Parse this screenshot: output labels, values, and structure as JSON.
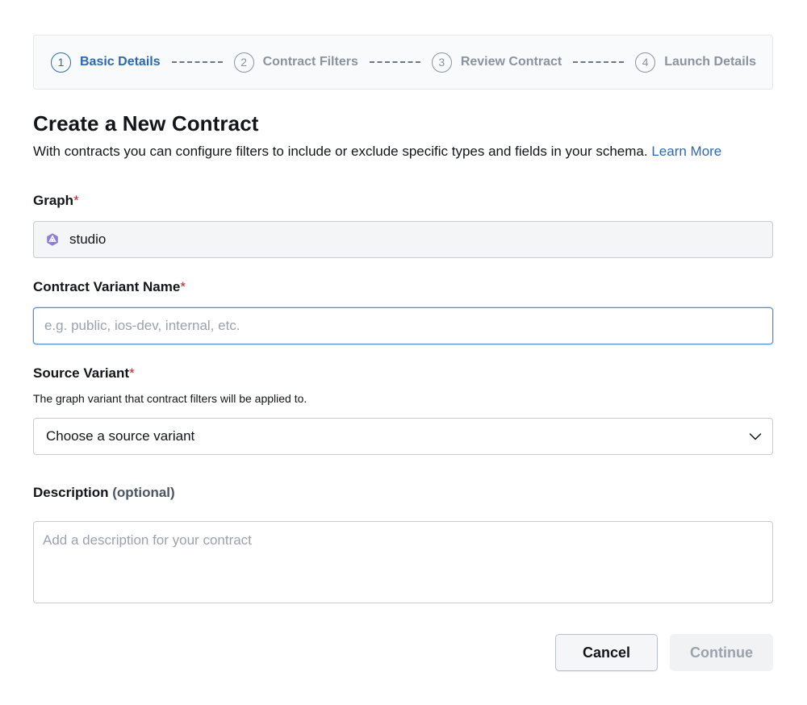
{
  "stepper": {
    "steps": [
      {
        "number": "1",
        "label": "Basic Details",
        "state": "active"
      },
      {
        "number": "2",
        "label": "Contract Filters",
        "state": "inactive"
      },
      {
        "number": "3",
        "label": "Review Contract",
        "state": "inactive"
      },
      {
        "number": "4",
        "label": "Launch Details",
        "state": "inactive"
      }
    ]
  },
  "header": {
    "title": "Create a New Contract",
    "subtitle": "With contracts you can configure filters to include or exclude specific types and fields in your schema.",
    "learn_more": "Learn More"
  },
  "form": {
    "graph": {
      "label": "Graph",
      "required_mark": "*",
      "value": "studio",
      "icon": "graph-icon"
    },
    "contract_variant_name": {
      "label": "Contract Variant Name",
      "required_mark": "*",
      "value": "",
      "placeholder": "e.g. public, ios-dev, internal, etc."
    },
    "source_variant": {
      "label": "Source Variant",
      "required_mark": "*",
      "help": "The graph variant that contract filters will be applied to.",
      "selected": "Choose a source variant"
    },
    "description": {
      "label": "Description",
      "optional_text": "(optional)",
      "value": "",
      "placeholder": "Add a description for your contract"
    }
  },
  "actions": {
    "cancel_label": "Cancel",
    "continue_label": "Continue"
  },
  "colors": {
    "accent": "#2a6ab3",
    "required": "#c8222a",
    "muted": "#8a93a1",
    "graph_icon": "#8f7ed6"
  }
}
